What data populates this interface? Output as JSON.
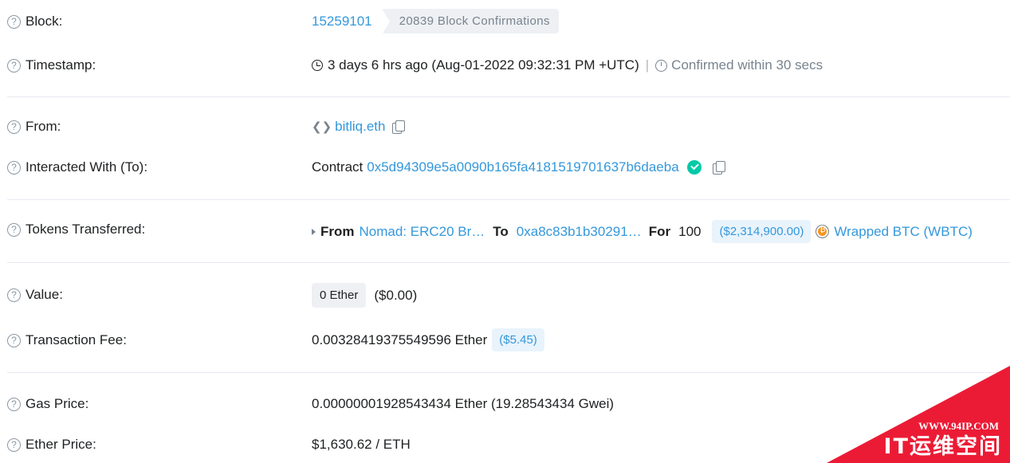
{
  "rows": {
    "block": {
      "label": "Block:",
      "number": "15259101",
      "confirmations": "20839 Block Confirmations"
    },
    "timestamp": {
      "label": "Timestamp:",
      "value": "3 days 6 hrs ago (Aug-01-2022 09:32:31 PM +UTC)",
      "separator": "|",
      "confirmed": "Confirmed within 30 secs"
    },
    "from": {
      "label": "From:",
      "address": "bitliq.eth"
    },
    "to": {
      "label": "Interacted With (To):",
      "prefix": "Contract",
      "address": "0x5d94309e5a0090b165fa4181519701637b6daeba"
    },
    "tokens": {
      "label": "Tokens Transferred:",
      "from_label": "From",
      "from_value": "Nomad: ERC20 Br…",
      "to_label": "To",
      "to_value": "0xa8c83b1b30291…",
      "for_label": "For",
      "amount": "100",
      "usd": "($2,314,900.00)",
      "token": "Wrapped BTC (WBTC)"
    },
    "value": {
      "label": "Value:",
      "ether": "0 Ether",
      "usd": "($0.00)"
    },
    "fee": {
      "label": "Transaction Fee:",
      "ether": "0.00328419375549596 Ether",
      "usd": "($5.45)"
    },
    "gas": {
      "label": "Gas Price:",
      "value": "0.00000001928543434 Ether (19.28543434 Gwei)"
    },
    "ether_price": {
      "label": "Ether Price:",
      "value": "$1,630.62 / ETH"
    }
  },
  "help_glyph": "?",
  "watermark": {
    "url": "WWW.94IP.COM",
    "name": "IT运维空间"
  },
  "colors": {
    "link": "#3498db",
    "verified": "#00c9a7",
    "watermark": "#ec1b35"
  }
}
